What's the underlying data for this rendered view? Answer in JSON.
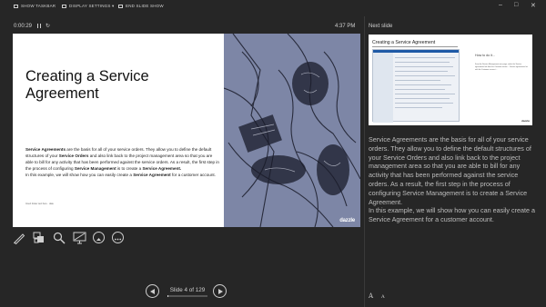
{
  "topbar": {
    "show_taskbar": "SHOW TASKBAR",
    "display_settings": "DISPLAY SETTINGS ▾",
    "end_slide_show": "END SLIDE SHOW",
    "window_controls": [
      "–",
      "□",
      "✕"
    ]
  },
  "presenter": {
    "timer": "0:00:29",
    "clock": "4:37 PM",
    "pause_icon": "pause-icon",
    "reset_icon": "reset-timer-icon"
  },
  "current_slide": {
    "title": "Creating a Service Agreement",
    "body": [
      [
        {
          "t": "Service Agreements",
          "b": true
        },
        {
          "t": " are the basis for all of your service orders.  They allow you to define the default structures of your ",
          "b": false
        },
        {
          "t": "Service Orders",
          "b": true
        },
        {
          "t": " and also link back to the project management area so that you are able to bill for any activity that has been performed against the service orders.  As a result, the first step in the process of configuring ",
          "b": false
        },
        {
          "t": "Service Management",
          "b": true
        },
        {
          "t": " is to create a ",
          "b": false
        },
        {
          "t": "Service Agreement.",
          "b": true
        }
      ],
      [
        {
          "t": "In this example, we will show how you can easily create a ",
          "b": false
        },
        {
          "t": "Service Agreement",
          "b": true
        },
        {
          "t": " for a customer account.",
          "b": false
        }
      ]
    ],
    "footer": "Insert footer text here · date",
    "logo": "dazzle",
    "art_color": "#7d86a6"
  },
  "tools": [
    "pen-icon",
    "see-all-slides-icon",
    "zoom-icon",
    "black-screen-icon",
    "more-options-icon"
  ],
  "next_slide": {
    "label": "Next slide",
    "title": "Creating a Service Agreement",
    "how_to": "How to do it...",
    "text": "From the Service Management area page, select the Service agreements link from the Common section ... Service agreements list with the Customer account ...",
    "logo": "dazzle"
  },
  "notes": "Service Agreements are the basis for all of your service orders.  They allow you to define the default structures of your Service Orders and also link back to the project management area so that you are able to bill for any activity that has been performed against the service orders.  As a result, the first step in the process of configuring Service Management is to create a Service Agreement.\nIn this example, we will show how you can easily create a Service Agreement for a customer account.",
  "font_controls": {
    "increase": "A",
    "decrease": "A"
  },
  "navigation": {
    "counter": "Slide 4 of 129",
    "current": 4,
    "total": 129
  }
}
